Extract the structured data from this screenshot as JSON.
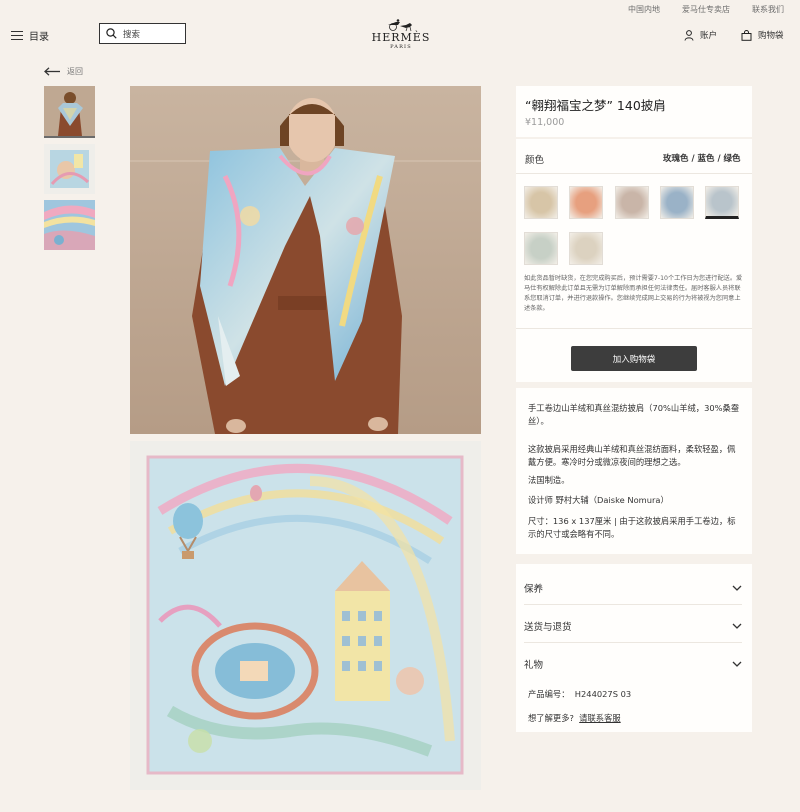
{
  "top_links": [
    "中国内地",
    "爱马仕专卖店",
    "联系我们"
  ],
  "header": {
    "menu_label": "目录",
    "search_placeholder": "搜索",
    "logo_word": "HERMÈS",
    "logo_city": "PARIS",
    "account_label": "账户",
    "cart_label": "购物袋"
  },
  "back_label": "返回",
  "product": {
    "title": "“翱翔福宝之梦” 140披肩",
    "price": "¥11,000",
    "color_label": "颜色",
    "color_value": "玫瑰色 / 蓝色 / 绿色",
    "swatch_colors": [
      "#d7c5a7",
      "#e7a07f",
      "#c9b5a8",
      "#9ab2c7",
      "#b9c4cb",
      "#c7d0c6",
      "#dcd2c0"
    ],
    "notice": "如此货品暂时缺货，在您完成购买后，预计需要7-10个工作日为您进行配送。爱马仕有权解除此订单且无需为订单解除而承担任何法律责任。届时客服人员将联系您取消订单，并进行退款操作。您继续完成网上交易的行为将被视为您同意上述条款。",
    "add_to_cart": "加入购物袋",
    "description": [
      "手工卷边山羊绒和真丝混纺披肩（70%山羊绒，30%桑蚕丝）。",
      "这款披肩采用经典山羊绒和真丝混纺面料，柔软轻盈，佩戴方便。寒冷时分或微凉夜间的理想之选。",
      "法国制造。",
      "设计师 野村大辅（Daiske Nomura）",
      "尺寸：136 x 137厘米 | 由于这款披肩采用手工卷边，标示的尺寸或会略有不同。"
    ],
    "accordion": [
      "保养",
      "送货与退货",
      "礼物"
    ],
    "reference_label": "产品编号：",
    "reference_value": "H244027S 03",
    "help_prefix": "想了解更多?",
    "help_link": "请联系客服"
  },
  "colors": {
    "background": "#f6f1eb",
    "panel": "#fffefc",
    "button": "#3d3d3d",
    "coat": "#8a4a2e",
    "photo_bg": "#bfa892"
  }
}
